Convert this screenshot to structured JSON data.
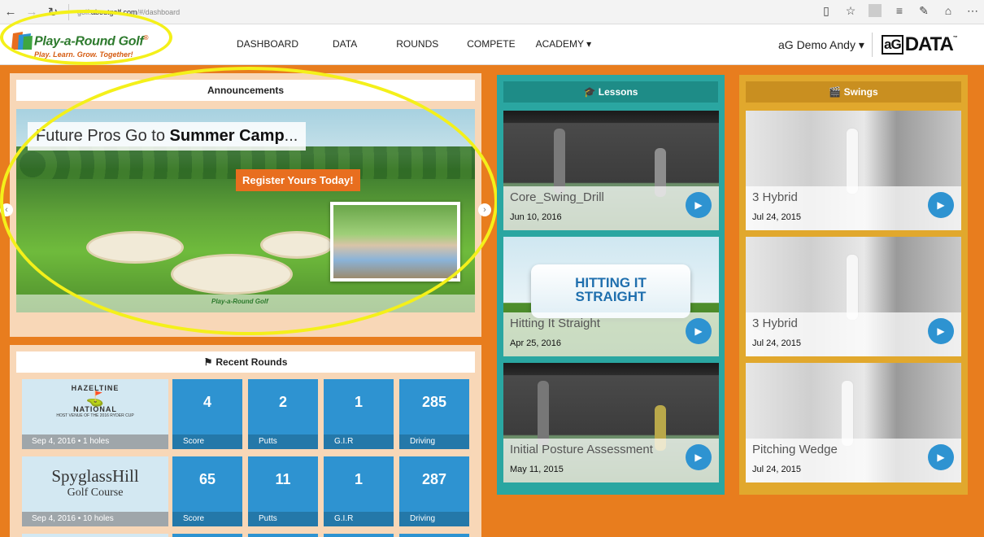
{
  "browser": {
    "url_prefix": "golf.",
    "url_host": "aboutgolf.com",
    "url_path": "/#/dashboard"
  },
  "header": {
    "logo_name": "Play-a-Round Golf",
    "logo_reg": "®",
    "logo_tagline": "Play. Learn. Grow. Together!",
    "nav": [
      {
        "label": "DASHBOARD"
      },
      {
        "label": "DATA"
      },
      {
        "label": "ROUNDS"
      },
      {
        "label": "COMPETE"
      },
      {
        "label": "ACADEMY ▾"
      }
    ],
    "user": "aG Demo Andy ▾",
    "brand_box": "aG",
    "brand_word": "DATA",
    "brand_tm": "™"
  },
  "announcements": {
    "title": "Announcements",
    "headline_prefix": "Future Pros Go to ",
    "headline_bold": "Summer Camp",
    "headline_suffix": "...",
    "cta": "Register Yours Today!",
    "footer_logo": "Play-a-Round Golf"
  },
  "recent_rounds": {
    "title": "Recent Rounds",
    "rounds": [
      {
        "course_line1": "HAZELTINE",
        "course_line2": "NATIONAL",
        "course_line3": "HOST VENUE OF THE 2016 RYDER CUP",
        "meta": "Sep 4, 2016 •  1 holes",
        "stats": [
          {
            "value": "4",
            "label": "Score"
          },
          {
            "value": "2",
            "label": "Putts"
          },
          {
            "value": "1",
            "label": "G.I.R"
          },
          {
            "value": "285",
            "label": "Driving"
          }
        ]
      },
      {
        "course_line1": "SpyglassHill",
        "course_line2": "Golf Course",
        "course_line3": "",
        "meta": "Sep 4, 2016 •  10 holes",
        "stats": [
          {
            "value": "65",
            "label": "Score"
          },
          {
            "value": "11",
            "label": "Putts"
          },
          {
            "value": "1",
            "label": "G.I.R"
          },
          {
            "value": "287",
            "label": "Driving"
          }
        ]
      }
    ]
  },
  "lessons": {
    "title": "Lessons",
    "items": [
      {
        "title": "Core_Swing_Drill",
        "date": "Jun 10, 2016"
      },
      {
        "title": "Hitting It Straight",
        "date": "Apr 25, 2016",
        "sign_line1": "HITTING IT",
        "sign_line2": "STRAIGHT"
      },
      {
        "title": "Initial Posture Assessment",
        "date": "May 11, 2015"
      }
    ]
  },
  "swings": {
    "title": "Swings",
    "items": [
      {
        "title": "3 Hybrid",
        "date": "Jul 24, 2015"
      },
      {
        "title": "3 Hybrid",
        "date": "Jul 24, 2015"
      },
      {
        "title": "Pitching Wedge",
        "date": "Jul 24, 2015"
      }
    ]
  },
  "icons": {
    "play": "play-icon",
    "lessons": "graduation-cap-icon",
    "swings": "film-clapper-icon",
    "flag": "flag-icon"
  },
  "colors": {
    "page_bg": "#e87d1e",
    "stat_blue": "#2e93d1",
    "lessons_teal": "#2aa6a1",
    "swings_gold": "#e1a82d",
    "highlight": "#f4f01a"
  }
}
